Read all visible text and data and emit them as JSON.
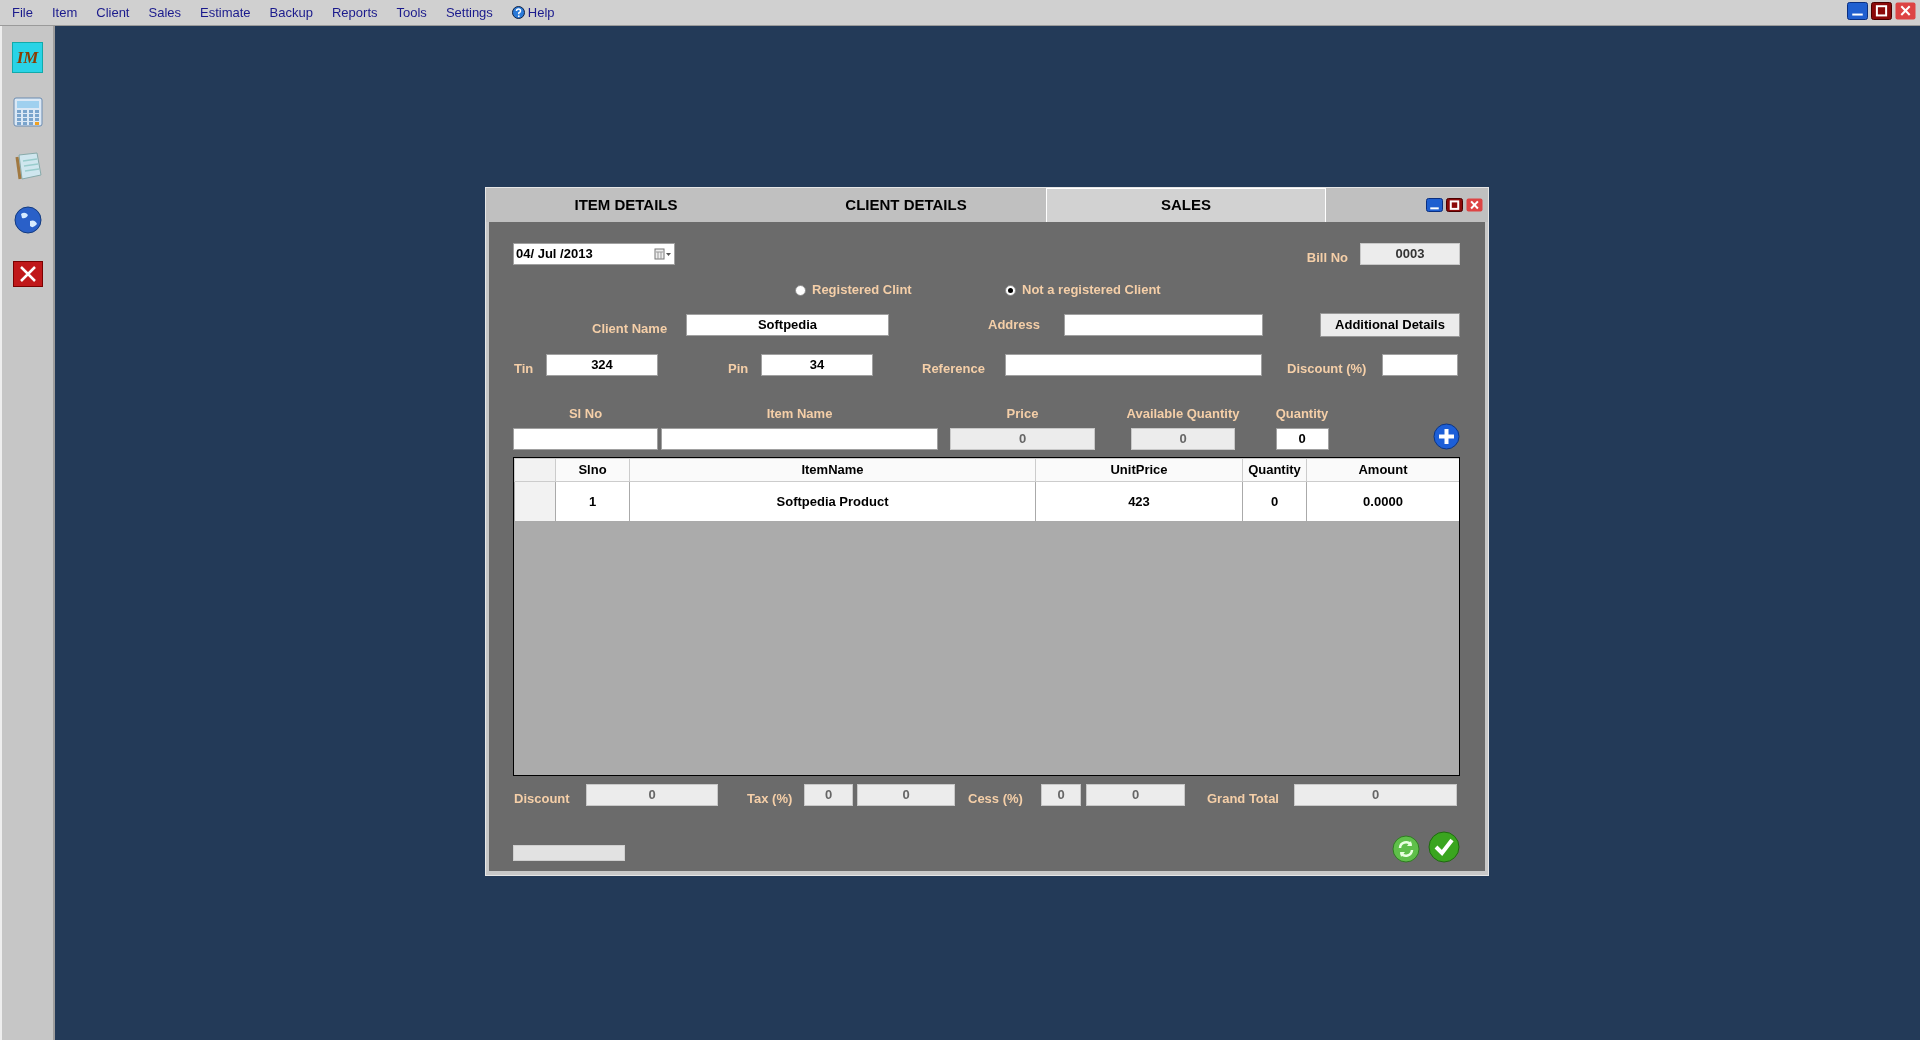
{
  "menu": [
    {
      "label": "File",
      "kind": "plain"
    },
    {
      "label": "Item",
      "kind": "plain"
    },
    {
      "label": "Client",
      "kind": "plain"
    },
    {
      "label": "Sales",
      "kind": "plain"
    },
    {
      "label": "Estimate",
      "kind": "plain"
    },
    {
      "label": "Backup",
      "kind": "plain"
    },
    {
      "label": "Reports",
      "kind": "plain"
    },
    {
      "label": "Tools",
      "kind": "plain"
    },
    {
      "label": "Settings",
      "kind": "plain"
    },
    {
      "label": "Help",
      "kind": "help"
    }
  ],
  "sidebar": {
    "logo_text": "IM"
  },
  "dialog": {
    "tabs": [
      {
        "label": "ITEM DETAILS",
        "selected": false
      },
      {
        "label": "CLIENT DETAILS",
        "selected": false
      },
      {
        "label": "SALES",
        "selected": true
      }
    ]
  },
  "form": {
    "date": "04/ Jul /2013",
    "bill_no": {
      "label": "Bill No",
      "value": "0003"
    },
    "client_type": [
      {
        "label": "Registered Clint",
        "selected": false
      },
      {
        "label": "Not a registered Client",
        "selected": true
      }
    ],
    "client_name": {
      "label": "Client Name",
      "value": "Softpedia"
    },
    "address": {
      "label": "Address"
    },
    "additional_button": "Additional Details",
    "tin": {
      "label": "Tin",
      "value": "324"
    },
    "pin": {
      "label": "Pin",
      "value": "34"
    },
    "reference": {
      "label": "Reference"
    },
    "discount_pct": {
      "label": "Discount (%)"
    }
  },
  "entry": [
    {
      "label": "Sl No",
      "disabled": false
    },
    {
      "label": "Item Name",
      "disabled": false
    },
    {
      "label": "Price",
      "value": "0",
      "disabled": true
    },
    {
      "label": "Available Quantity",
      "value": "0",
      "disabled": true
    },
    {
      "label": "Quantity",
      "value": "0",
      "disabled": false
    }
  ],
  "table": {
    "columns": [
      "Slno",
      "ItemName",
      "UnitPrice",
      "Quantity",
      "Amount"
    ],
    "rows": [
      [
        "1",
        "Softpedia Product",
        "423",
        "0",
        "0.0000"
      ]
    ]
  },
  "totals": [
    {
      "label": "Discount",
      "fields": [
        "0"
      ]
    },
    {
      "label": "Tax (%)",
      "fields": [
        "0",
        "0"
      ]
    },
    {
      "label": "Cess (%)",
      "fields": [
        "0",
        "0"
      ]
    },
    {
      "label": "Grand Total",
      "fields": [
        "0"
      ]
    }
  ],
  "progress": {
    "level": 0
  }
}
